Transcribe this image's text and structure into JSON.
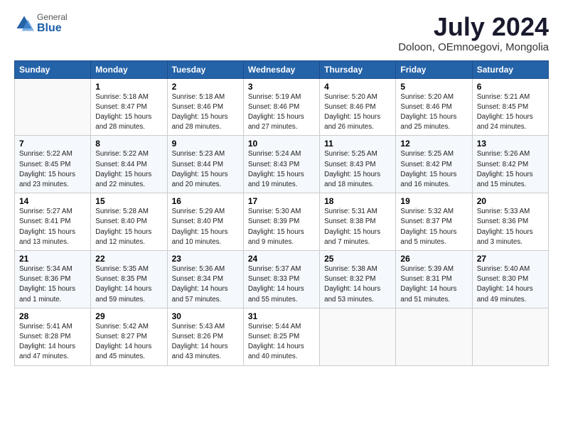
{
  "logo": {
    "general": "General",
    "blue": "Blue"
  },
  "title": "July 2024",
  "subtitle": "Doloon, OEmnoegovi, Mongolia",
  "headers": [
    "Sunday",
    "Monday",
    "Tuesday",
    "Wednesday",
    "Thursday",
    "Friday",
    "Saturday"
  ],
  "weeks": [
    [
      {
        "date": "",
        "info": ""
      },
      {
        "date": "1",
        "info": "Sunrise: 5:18 AM\nSunset: 8:47 PM\nDaylight: 15 hours\nand 28 minutes."
      },
      {
        "date": "2",
        "info": "Sunrise: 5:18 AM\nSunset: 8:46 PM\nDaylight: 15 hours\nand 28 minutes."
      },
      {
        "date": "3",
        "info": "Sunrise: 5:19 AM\nSunset: 8:46 PM\nDaylight: 15 hours\nand 27 minutes."
      },
      {
        "date": "4",
        "info": "Sunrise: 5:20 AM\nSunset: 8:46 PM\nDaylight: 15 hours\nand 26 minutes."
      },
      {
        "date": "5",
        "info": "Sunrise: 5:20 AM\nSunset: 8:46 PM\nDaylight: 15 hours\nand 25 minutes."
      },
      {
        "date": "6",
        "info": "Sunrise: 5:21 AM\nSunset: 8:45 PM\nDaylight: 15 hours\nand 24 minutes."
      }
    ],
    [
      {
        "date": "7",
        "info": "Sunrise: 5:22 AM\nSunset: 8:45 PM\nDaylight: 15 hours\nand 23 minutes."
      },
      {
        "date": "8",
        "info": "Sunrise: 5:22 AM\nSunset: 8:44 PM\nDaylight: 15 hours\nand 22 minutes."
      },
      {
        "date": "9",
        "info": "Sunrise: 5:23 AM\nSunset: 8:44 PM\nDaylight: 15 hours\nand 20 minutes."
      },
      {
        "date": "10",
        "info": "Sunrise: 5:24 AM\nSunset: 8:43 PM\nDaylight: 15 hours\nand 19 minutes."
      },
      {
        "date": "11",
        "info": "Sunrise: 5:25 AM\nSunset: 8:43 PM\nDaylight: 15 hours\nand 18 minutes."
      },
      {
        "date": "12",
        "info": "Sunrise: 5:25 AM\nSunset: 8:42 PM\nDaylight: 15 hours\nand 16 minutes."
      },
      {
        "date": "13",
        "info": "Sunrise: 5:26 AM\nSunset: 8:42 PM\nDaylight: 15 hours\nand 15 minutes."
      }
    ],
    [
      {
        "date": "14",
        "info": "Sunrise: 5:27 AM\nSunset: 8:41 PM\nDaylight: 15 hours\nand 13 minutes."
      },
      {
        "date": "15",
        "info": "Sunrise: 5:28 AM\nSunset: 8:40 PM\nDaylight: 15 hours\nand 12 minutes."
      },
      {
        "date": "16",
        "info": "Sunrise: 5:29 AM\nSunset: 8:40 PM\nDaylight: 15 hours\nand 10 minutes."
      },
      {
        "date": "17",
        "info": "Sunrise: 5:30 AM\nSunset: 8:39 PM\nDaylight: 15 hours\nand 9 minutes."
      },
      {
        "date": "18",
        "info": "Sunrise: 5:31 AM\nSunset: 8:38 PM\nDaylight: 15 hours\nand 7 minutes."
      },
      {
        "date": "19",
        "info": "Sunrise: 5:32 AM\nSunset: 8:37 PM\nDaylight: 15 hours\nand 5 minutes."
      },
      {
        "date": "20",
        "info": "Sunrise: 5:33 AM\nSunset: 8:36 PM\nDaylight: 15 hours\nand 3 minutes."
      }
    ],
    [
      {
        "date": "21",
        "info": "Sunrise: 5:34 AM\nSunset: 8:36 PM\nDaylight: 15 hours\nand 1 minute."
      },
      {
        "date": "22",
        "info": "Sunrise: 5:35 AM\nSunset: 8:35 PM\nDaylight: 14 hours\nand 59 minutes."
      },
      {
        "date": "23",
        "info": "Sunrise: 5:36 AM\nSunset: 8:34 PM\nDaylight: 14 hours\nand 57 minutes."
      },
      {
        "date": "24",
        "info": "Sunrise: 5:37 AM\nSunset: 8:33 PM\nDaylight: 14 hours\nand 55 minutes."
      },
      {
        "date": "25",
        "info": "Sunrise: 5:38 AM\nSunset: 8:32 PM\nDaylight: 14 hours\nand 53 minutes."
      },
      {
        "date": "26",
        "info": "Sunrise: 5:39 AM\nSunset: 8:31 PM\nDaylight: 14 hours\nand 51 minutes."
      },
      {
        "date": "27",
        "info": "Sunrise: 5:40 AM\nSunset: 8:30 PM\nDaylight: 14 hours\nand 49 minutes."
      }
    ],
    [
      {
        "date": "28",
        "info": "Sunrise: 5:41 AM\nSunset: 8:28 PM\nDaylight: 14 hours\nand 47 minutes."
      },
      {
        "date": "29",
        "info": "Sunrise: 5:42 AM\nSunset: 8:27 PM\nDaylight: 14 hours\nand 45 minutes."
      },
      {
        "date": "30",
        "info": "Sunrise: 5:43 AM\nSunset: 8:26 PM\nDaylight: 14 hours\nand 43 minutes."
      },
      {
        "date": "31",
        "info": "Sunrise: 5:44 AM\nSunset: 8:25 PM\nDaylight: 14 hours\nand 40 minutes."
      },
      {
        "date": "",
        "info": ""
      },
      {
        "date": "",
        "info": ""
      },
      {
        "date": "",
        "info": ""
      }
    ]
  ]
}
